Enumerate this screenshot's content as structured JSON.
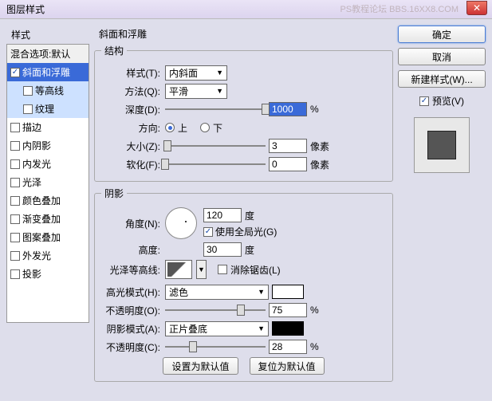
{
  "title": "图层样式",
  "watermark": "PS教程论坛\nBBS.16XX8.COM",
  "leftpanel": {
    "header": "样式",
    "items": [
      {
        "label": "混合选项:默认",
        "checked": null,
        "type": "default"
      },
      {
        "label": "斜面和浮雕",
        "checked": true,
        "type": "sel"
      },
      {
        "label": "等高线",
        "checked": false,
        "type": "sub hl"
      },
      {
        "label": "纹理",
        "checked": false,
        "type": "sub hl"
      },
      {
        "label": "描边",
        "checked": false,
        "type": ""
      },
      {
        "label": "内阴影",
        "checked": false,
        "type": ""
      },
      {
        "label": "内发光",
        "checked": false,
        "type": ""
      },
      {
        "label": "光泽",
        "checked": false,
        "type": ""
      },
      {
        "label": "颜色叠加",
        "checked": false,
        "type": ""
      },
      {
        "label": "渐变叠加",
        "checked": false,
        "type": ""
      },
      {
        "label": "图案叠加",
        "checked": false,
        "type": ""
      },
      {
        "label": "外发光",
        "checked": false,
        "type": ""
      },
      {
        "label": "投影",
        "checked": false,
        "type": ""
      }
    ]
  },
  "center": {
    "heading": "斜面和浮雕",
    "structureLegend": "结构",
    "styleLabel": "样式(T):",
    "styleValue": "内斜面",
    "methodLabel": "方法(Q):",
    "methodValue": "平滑",
    "depthLabel": "深度(D):",
    "depthValue": "1000",
    "depthUnit": "%",
    "directionLabel": "方向:",
    "upLabel": "上",
    "downLabel": "下",
    "sizeLabel": "大小(Z):",
    "sizeValue": "3",
    "sizeUnit": "像素",
    "softenLabel": "软化(F):",
    "softenValue": "0",
    "softenUnit": "像素",
    "shadingLegend": "阴影",
    "angleLabel": "角度(N):",
    "angleValue": "120",
    "angleUnit": "度",
    "globalLabel": "使用全局光(G)",
    "altitudeLabel": "高度:",
    "altitudeValue": "30",
    "altitudeUnit": "度",
    "glossLabel": "光泽等高线:",
    "antiAliasLabel": "消除锯齿(L)",
    "hiliteModeLabel": "高光模式(H):",
    "hiliteModeValue": "滤色",
    "hiliteOpacLabel": "不透明度(O):",
    "hiliteOpacValue": "75",
    "pctUnit": "%",
    "shadowModeLabel": "阴影模式(A):",
    "shadowModeValue": "正片叠底",
    "shadowOpacLabel": "不透明度(C):",
    "shadowOpacValue": "28",
    "btnDefault": "设置为默认值",
    "btnReset": "复位为默认值"
  },
  "rightpanel": {
    "ok": "确定",
    "cancel": "取消",
    "newStyle": "新建样式(W)...",
    "previewLabel": "预览(V)"
  }
}
